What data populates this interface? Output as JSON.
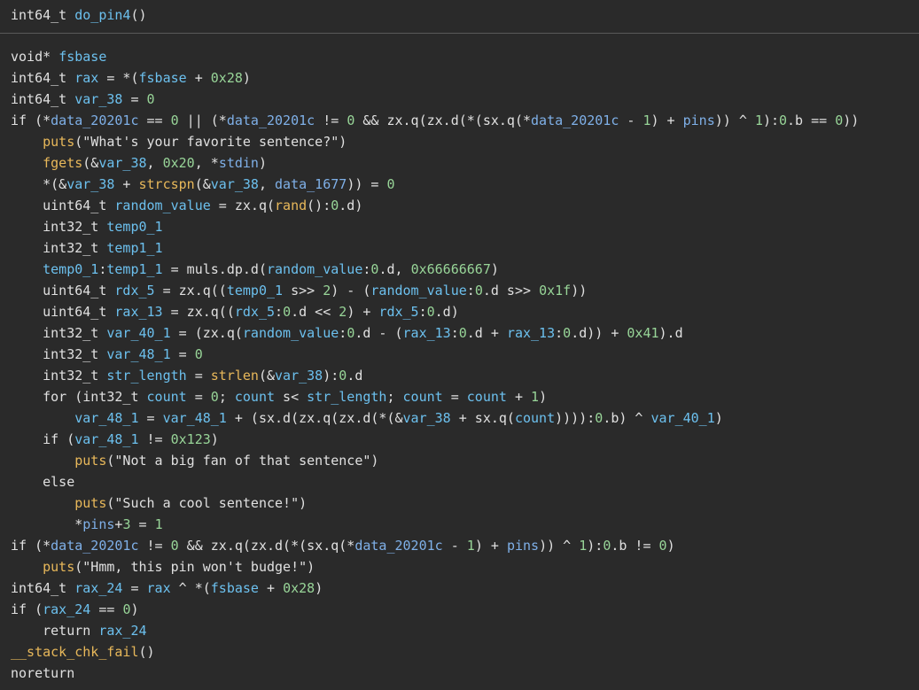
{
  "colors": {
    "background": "#2a2a2a",
    "plain": "#e0e0e0",
    "variable": "#6cc0ee",
    "number": "#98d598",
    "function": "#e8b85a",
    "data_symbol": "#7fb0e8"
  },
  "header": {
    "tokens": [
      {
        "t": "int64_t ",
        "c": "plain"
      },
      {
        "t": "do_pin4",
        "c": "var"
      },
      {
        "t": "()",
        "c": "plain"
      }
    ]
  },
  "lines": [
    {
      "indent": 0,
      "tokens": [
        {
          "t": "void* ",
          "c": "plain"
        },
        {
          "t": "fsbase",
          "c": "var"
        }
      ]
    },
    {
      "indent": 0,
      "tokens": [
        {
          "t": "int64_t ",
          "c": "plain"
        },
        {
          "t": "rax",
          "c": "var"
        },
        {
          "t": " = *(",
          "c": "plain"
        },
        {
          "t": "fsbase",
          "c": "var"
        },
        {
          "t": " + ",
          "c": "plain"
        },
        {
          "t": "0x28",
          "c": "num"
        },
        {
          "t": ")",
          "c": "plain"
        }
      ]
    },
    {
      "indent": 0,
      "tokens": [
        {
          "t": "int64_t ",
          "c": "plain"
        },
        {
          "t": "var_38",
          "c": "var"
        },
        {
          "t": " = ",
          "c": "plain"
        },
        {
          "t": "0",
          "c": "num"
        }
      ]
    },
    {
      "indent": 0,
      "tokens": [
        {
          "t": "if (*",
          "c": "plain"
        },
        {
          "t": "data_20201c",
          "c": "data"
        },
        {
          "t": " == ",
          "c": "plain"
        },
        {
          "t": "0",
          "c": "num"
        },
        {
          "t": " || (*",
          "c": "plain"
        },
        {
          "t": "data_20201c",
          "c": "data"
        },
        {
          "t": " != ",
          "c": "plain"
        },
        {
          "t": "0",
          "c": "num"
        },
        {
          "t": " && zx.q(zx.d(*(sx.q(*",
          "c": "plain"
        },
        {
          "t": "data_20201c",
          "c": "data"
        },
        {
          "t": " - ",
          "c": "plain"
        },
        {
          "t": "1",
          "c": "num"
        },
        {
          "t": ") + ",
          "c": "plain"
        },
        {
          "t": "pins",
          "c": "data"
        },
        {
          "t": ")) ^ ",
          "c": "plain"
        },
        {
          "t": "1",
          "c": "num"
        },
        {
          "t": "):",
          "c": "plain"
        },
        {
          "t": "0",
          "c": "num"
        },
        {
          "t": ".b == ",
          "c": "plain"
        },
        {
          "t": "0",
          "c": "num"
        },
        {
          "t": "))",
          "c": "plain"
        }
      ]
    },
    {
      "indent": 1,
      "tokens": [
        {
          "t": "puts",
          "c": "func"
        },
        {
          "t": "(\"What's your favorite sentence?\")",
          "c": "plain"
        }
      ]
    },
    {
      "indent": 1,
      "tokens": [
        {
          "t": "fgets",
          "c": "func"
        },
        {
          "t": "(&",
          "c": "plain"
        },
        {
          "t": "var_38",
          "c": "var"
        },
        {
          "t": ", ",
          "c": "plain"
        },
        {
          "t": "0x20",
          "c": "num"
        },
        {
          "t": ", *",
          "c": "plain"
        },
        {
          "t": "stdin",
          "c": "data"
        },
        {
          "t": ")",
          "c": "plain"
        }
      ]
    },
    {
      "indent": 1,
      "tokens": [
        {
          "t": "*(&",
          "c": "plain"
        },
        {
          "t": "var_38",
          "c": "var"
        },
        {
          "t": " + ",
          "c": "plain"
        },
        {
          "t": "strcspn",
          "c": "func"
        },
        {
          "t": "(&",
          "c": "plain"
        },
        {
          "t": "var_38",
          "c": "var"
        },
        {
          "t": ", ",
          "c": "plain"
        },
        {
          "t": "data_1677",
          "c": "data"
        },
        {
          "t": ")) = ",
          "c": "plain"
        },
        {
          "t": "0",
          "c": "num"
        }
      ]
    },
    {
      "indent": 1,
      "tokens": [
        {
          "t": "uint64_t ",
          "c": "plain"
        },
        {
          "t": "random_value",
          "c": "var"
        },
        {
          "t": " = zx.q(",
          "c": "plain"
        },
        {
          "t": "rand",
          "c": "func"
        },
        {
          "t": "():",
          "c": "plain"
        },
        {
          "t": "0",
          "c": "num"
        },
        {
          "t": ".d)",
          "c": "plain"
        }
      ]
    },
    {
      "indent": 1,
      "tokens": [
        {
          "t": "int32_t ",
          "c": "plain"
        },
        {
          "t": "temp0_1",
          "c": "var"
        }
      ]
    },
    {
      "indent": 1,
      "tokens": [
        {
          "t": "int32_t ",
          "c": "plain"
        },
        {
          "t": "temp1_1",
          "c": "var"
        }
      ]
    },
    {
      "indent": 1,
      "tokens": [
        {
          "t": "temp0_1",
          "c": "var"
        },
        {
          "t": ":",
          "c": "plain"
        },
        {
          "t": "temp1_1",
          "c": "var"
        },
        {
          "t": " = muls.dp.d(",
          "c": "plain"
        },
        {
          "t": "random_value",
          "c": "var"
        },
        {
          "t": ":",
          "c": "plain"
        },
        {
          "t": "0",
          "c": "num"
        },
        {
          "t": ".d, ",
          "c": "plain"
        },
        {
          "t": "0x66666667",
          "c": "num"
        },
        {
          "t": ")",
          "c": "plain"
        }
      ]
    },
    {
      "indent": 1,
      "tokens": [
        {
          "t": "uint64_t ",
          "c": "plain"
        },
        {
          "t": "rdx_5",
          "c": "var"
        },
        {
          "t": " = zx.q((",
          "c": "plain"
        },
        {
          "t": "temp0_1",
          "c": "var"
        },
        {
          "t": " s>> ",
          "c": "plain"
        },
        {
          "t": "2",
          "c": "num"
        },
        {
          "t": ") - (",
          "c": "plain"
        },
        {
          "t": "random_value",
          "c": "var"
        },
        {
          "t": ":",
          "c": "plain"
        },
        {
          "t": "0",
          "c": "num"
        },
        {
          "t": ".d s>> ",
          "c": "plain"
        },
        {
          "t": "0x1f",
          "c": "num"
        },
        {
          "t": "))",
          "c": "plain"
        }
      ]
    },
    {
      "indent": 1,
      "tokens": [
        {
          "t": "uint64_t ",
          "c": "plain"
        },
        {
          "t": "rax_13",
          "c": "var"
        },
        {
          "t": " = zx.q((",
          "c": "plain"
        },
        {
          "t": "rdx_5",
          "c": "var"
        },
        {
          "t": ":",
          "c": "plain"
        },
        {
          "t": "0",
          "c": "num"
        },
        {
          "t": ".d << ",
          "c": "plain"
        },
        {
          "t": "2",
          "c": "num"
        },
        {
          "t": ") + ",
          "c": "plain"
        },
        {
          "t": "rdx_5",
          "c": "var"
        },
        {
          "t": ":",
          "c": "plain"
        },
        {
          "t": "0",
          "c": "num"
        },
        {
          "t": ".d)",
          "c": "plain"
        }
      ]
    },
    {
      "indent": 1,
      "tokens": [
        {
          "t": "int32_t ",
          "c": "plain"
        },
        {
          "t": "var_40_1",
          "c": "var"
        },
        {
          "t": " = (zx.q(",
          "c": "plain"
        },
        {
          "t": "random_value",
          "c": "var"
        },
        {
          "t": ":",
          "c": "plain"
        },
        {
          "t": "0",
          "c": "num"
        },
        {
          "t": ".d - (",
          "c": "plain"
        },
        {
          "t": "rax_13",
          "c": "var"
        },
        {
          "t": ":",
          "c": "plain"
        },
        {
          "t": "0",
          "c": "num"
        },
        {
          "t": ".d + ",
          "c": "plain"
        },
        {
          "t": "rax_13",
          "c": "var"
        },
        {
          "t": ":",
          "c": "plain"
        },
        {
          "t": "0",
          "c": "num"
        },
        {
          "t": ".d)) + ",
          "c": "plain"
        },
        {
          "t": "0x41",
          "c": "num"
        },
        {
          "t": ").d",
          "c": "plain"
        }
      ]
    },
    {
      "indent": 1,
      "tokens": [
        {
          "t": "int32_t ",
          "c": "plain"
        },
        {
          "t": "var_48_1",
          "c": "var"
        },
        {
          "t": " = ",
          "c": "plain"
        },
        {
          "t": "0",
          "c": "num"
        }
      ]
    },
    {
      "indent": 1,
      "tokens": [
        {
          "t": "int32_t ",
          "c": "plain"
        },
        {
          "t": "str_length",
          "c": "var"
        },
        {
          "t": " = ",
          "c": "plain"
        },
        {
          "t": "strlen",
          "c": "func"
        },
        {
          "t": "(&",
          "c": "plain"
        },
        {
          "t": "var_38",
          "c": "var"
        },
        {
          "t": "):",
          "c": "plain"
        },
        {
          "t": "0",
          "c": "num"
        },
        {
          "t": ".d",
          "c": "plain"
        }
      ]
    },
    {
      "indent": 1,
      "tokens": [
        {
          "t": "for (int32_t ",
          "c": "plain"
        },
        {
          "t": "count",
          "c": "var"
        },
        {
          "t": " = ",
          "c": "plain"
        },
        {
          "t": "0",
          "c": "num"
        },
        {
          "t": "; ",
          "c": "plain"
        },
        {
          "t": "count",
          "c": "var"
        },
        {
          "t": " s< ",
          "c": "plain"
        },
        {
          "t": "str_length",
          "c": "var"
        },
        {
          "t": "; ",
          "c": "plain"
        },
        {
          "t": "count",
          "c": "var"
        },
        {
          "t": " = ",
          "c": "plain"
        },
        {
          "t": "count",
          "c": "var"
        },
        {
          "t": " + ",
          "c": "plain"
        },
        {
          "t": "1",
          "c": "num"
        },
        {
          "t": ")",
          "c": "plain"
        }
      ]
    },
    {
      "indent": 2,
      "tokens": [
        {
          "t": "var_48_1",
          "c": "var"
        },
        {
          "t": " = ",
          "c": "plain"
        },
        {
          "t": "var_48_1",
          "c": "var"
        },
        {
          "t": " + (sx.d(zx.q(zx.d(*(&",
          "c": "plain"
        },
        {
          "t": "var_38",
          "c": "var"
        },
        {
          "t": " + sx.q(",
          "c": "plain"
        },
        {
          "t": "count",
          "c": "var"
        },
        {
          "t": ")))):",
          "c": "plain"
        },
        {
          "t": "0",
          "c": "num"
        },
        {
          "t": ".b) ^ ",
          "c": "plain"
        },
        {
          "t": "var_40_1",
          "c": "var"
        },
        {
          "t": ")",
          "c": "plain"
        }
      ]
    },
    {
      "indent": 1,
      "tokens": [
        {
          "t": "if (",
          "c": "plain"
        },
        {
          "t": "var_48_1",
          "c": "var"
        },
        {
          "t": " != ",
          "c": "plain"
        },
        {
          "t": "0x123",
          "c": "num"
        },
        {
          "t": ")",
          "c": "plain"
        }
      ]
    },
    {
      "indent": 2,
      "tokens": [
        {
          "t": "puts",
          "c": "func"
        },
        {
          "t": "(\"Not a big fan of that sentence\")",
          "c": "plain"
        }
      ]
    },
    {
      "indent": 1,
      "tokens": [
        {
          "t": "else",
          "c": "plain"
        }
      ]
    },
    {
      "indent": 2,
      "tokens": [
        {
          "t": "puts",
          "c": "func"
        },
        {
          "t": "(\"Such a cool sentence!\")",
          "c": "plain"
        }
      ]
    },
    {
      "indent": 2,
      "tokens": [
        {
          "t": "*",
          "c": "plain"
        },
        {
          "t": "pins",
          "c": "data"
        },
        {
          "t": "+",
          "c": "plain"
        },
        {
          "t": "3",
          "c": "num"
        },
        {
          "t": " = ",
          "c": "plain"
        },
        {
          "t": "1",
          "c": "num"
        }
      ]
    },
    {
      "indent": 0,
      "tokens": [
        {
          "t": "if (*",
          "c": "plain"
        },
        {
          "t": "data_20201c",
          "c": "data"
        },
        {
          "t": " != ",
          "c": "plain"
        },
        {
          "t": "0",
          "c": "num"
        },
        {
          "t": " && zx.q(zx.d(*(sx.q(*",
          "c": "plain"
        },
        {
          "t": "data_20201c",
          "c": "data"
        },
        {
          "t": " - ",
          "c": "plain"
        },
        {
          "t": "1",
          "c": "num"
        },
        {
          "t": ") + ",
          "c": "plain"
        },
        {
          "t": "pins",
          "c": "data"
        },
        {
          "t": ")) ^ ",
          "c": "plain"
        },
        {
          "t": "1",
          "c": "num"
        },
        {
          "t": "):",
          "c": "plain"
        },
        {
          "t": "0",
          "c": "num"
        },
        {
          "t": ".b != ",
          "c": "plain"
        },
        {
          "t": "0",
          "c": "num"
        },
        {
          "t": ")",
          "c": "plain"
        }
      ]
    },
    {
      "indent": 1,
      "tokens": [
        {
          "t": "puts",
          "c": "func"
        },
        {
          "t": "(\"Hmm, this pin won't budge!\")",
          "c": "plain"
        }
      ]
    },
    {
      "indent": 0,
      "tokens": [
        {
          "t": "int64_t ",
          "c": "plain"
        },
        {
          "t": "rax_24",
          "c": "var"
        },
        {
          "t": " = ",
          "c": "plain"
        },
        {
          "t": "rax",
          "c": "var"
        },
        {
          "t": " ^ *(",
          "c": "plain"
        },
        {
          "t": "fsbase",
          "c": "var"
        },
        {
          "t": " + ",
          "c": "plain"
        },
        {
          "t": "0x28",
          "c": "num"
        },
        {
          "t": ")",
          "c": "plain"
        }
      ]
    },
    {
      "indent": 0,
      "tokens": [
        {
          "t": "if (",
          "c": "plain"
        },
        {
          "t": "rax_24",
          "c": "var"
        },
        {
          "t": " == ",
          "c": "plain"
        },
        {
          "t": "0",
          "c": "num"
        },
        {
          "t": ")",
          "c": "plain"
        }
      ]
    },
    {
      "indent": 1,
      "tokens": [
        {
          "t": "return ",
          "c": "plain"
        },
        {
          "t": "rax_24",
          "c": "var"
        }
      ]
    },
    {
      "indent": 0,
      "tokens": [
        {
          "t": "__stack_chk_fail",
          "c": "func"
        },
        {
          "t": "()",
          "c": "plain"
        }
      ]
    },
    {
      "indent": 0,
      "tokens": [
        {
          "t": "noreturn",
          "c": "plain"
        }
      ]
    }
  ]
}
